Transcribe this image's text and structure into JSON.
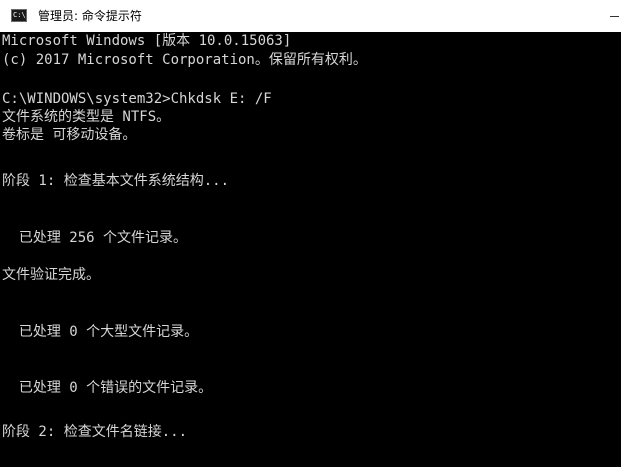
{
  "window": {
    "title": "管理员: 命令提示符",
    "icon_text": "C:\\_",
    "icon": "console-window-icon",
    "minimize_icon": "minimize-icon"
  },
  "colors": {
    "background": "#000000",
    "text": "#d6d6d6",
    "titlebar": "#ffffff"
  },
  "console": {
    "lines": [
      "Microsoft Windows [版本 10.0.15063]",
      "(c) 2017 Microsoft Corporation。保留所有权利。",
      "C:\\WINDOWS\\system32>Chkdsk E: /F",
      "文件系统的类型是 NTFS。",
      "卷标是 可移动设备。",
      "阶段 1: 检查基本文件系统结构...",
      "  已处理 256 个文件记录。",
      "文件验证完成。",
      "  已处理 0 个大型文件记录。",
      "  已处理 0 个错误的文件记录。",
      "阶段 2: 检查文件名链接..."
    ]
  }
}
